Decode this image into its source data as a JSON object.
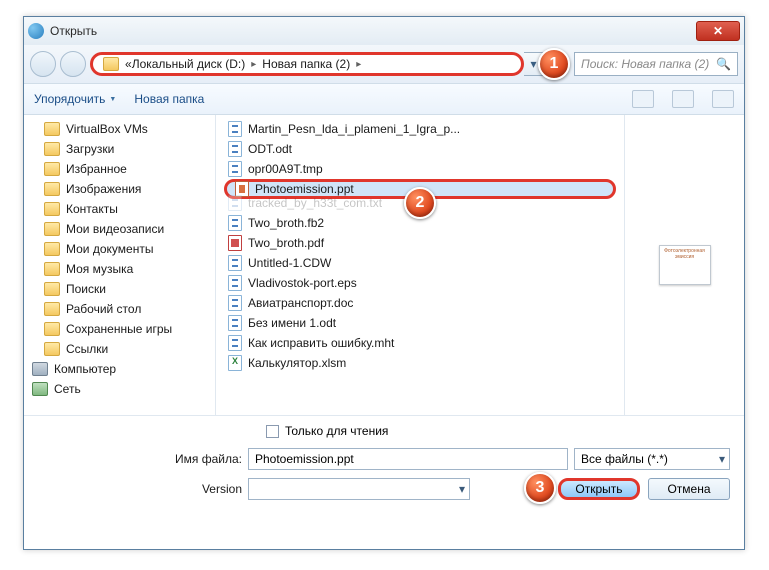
{
  "window": {
    "title": "Открыть"
  },
  "breadcrumb": {
    "prefix_glyph": "«",
    "parts": [
      "Локальный диск (D:)",
      "Новая папка (2)"
    ]
  },
  "search": {
    "placeholder": "Поиск: Новая папка (2)"
  },
  "toolbar": {
    "organize": "Упорядочить",
    "newfolder": "Новая папка"
  },
  "tree": [
    {
      "label": "VirtualBox VMs",
      "icon": "folder"
    },
    {
      "label": "Загрузки",
      "icon": "folder"
    },
    {
      "label": "Избранное",
      "icon": "folder"
    },
    {
      "label": "Изображения",
      "icon": "folder"
    },
    {
      "label": "Контакты",
      "icon": "folder"
    },
    {
      "label": "Мои видеозаписи",
      "icon": "folder"
    },
    {
      "label": "Мои документы",
      "icon": "folder"
    },
    {
      "label": "Моя музыка",
      "icon": "folder"
    },
    {
      "label": "Поиски",
      "icon": "folder"
    },
    {
      "label": "Рабочий стол",
      "icon": "folder"
    },
    {
      "label": "Сохраненные игры",
      "icon": "folder"
    },
    {
      "label": "Ссылки",
      "icon": "folder"
    },
    {
      "label": "Компьютер",
      "icon": "comp",
      "lv": 1
    },
    {
      "label": "Сеть",
      "icon": "net",
      "lv": 1
    }
  ],
  "files": [
    {
      "name": "Martin_Pesn_lda_i_plameni_1_Igra_p...",
      "type": "doc"
    },
    {
      "name": "ODT.odt",
      "type": "doc"
    },
    {
      "name": "opr00A9T.tmp",
      "type": "doc"
    },
    {
      "name": "Photoemission.ppt",
      "type": "ppt",
      "selected": true
    },
    {
      "name": "tracked_by_h33t_com.txt",
      "type": "doc",
      "obscured": true
    },
    {
      "name": "Two_broth.fb2",
      "type": "doc"
    },
    {
      "name": "Two_broth.pdf",
      "type": "pdf"
    },
    {
      "name": "Untitled-1.CDW",
      "type": "doc"
    },
    {
      "name": "Vladivostok-port.eps",
      "type": "doc"
    },
    {
      "name": "Авиатранспорт.doc",
      "type": "doc"
    },
    {
      "name": "Без имени 1.odt",
      "type": "doc"
    },
    {
      "name": "Как исправить ошибку.mht",
      "type": "doc"
    },
    {
      "name": "Калькулятор.xlsm",
      "type": "xls"
    }
  ],
  "readonly_label": "Только для чтения",
  "filename_label": "Имя файла:",
  "filename_value": "Photoemission.ppt",
  "filter_value": "Все файлы (*.*)",
  "version_label": "Version",
  "version_selected": "",
  "buttons": {
    "open": "Открыть",
    "cancel": "Отмена"
  },
  "markers": {
    "m1": "1",
    "m2": "2",
    "m3": "3"
  },
  "preview_text": "Фотоэлектронная эмиссия"
}
